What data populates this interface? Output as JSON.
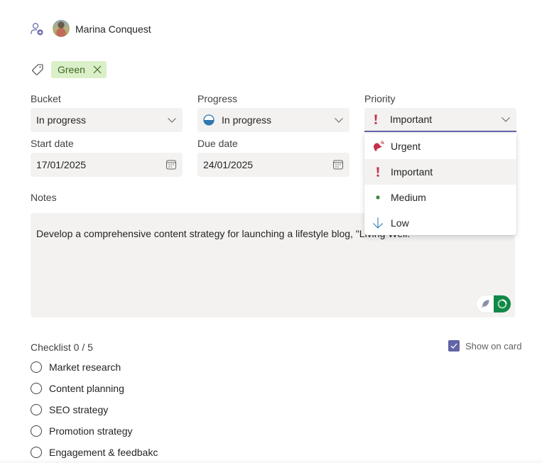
{
  "assignment": {
    "assignee_name": "Marina Conquest",
    "icon": "add-assignee-icon"
  },
  "labels": {
    "icon": "tag-icon",
    "items": [
      {
        "name": "Green",
        "bg_color": "#dbefc8",
        "text_color": "#3d6b22"
      }
    ]
  },
  "fields": {
    "bucket": {
      "label": "Bucket",
      "value": "In progress"
    },
    "progress": {
      "label": "Progress",
      "value": "In progress",
      "icon": "half-circle-progress-icon"
    },
    "priority": {
      "label": "Priority",
      "value": "Important",
      "icon": "exclamation-icon"
    },
    "start_date": {
      "label": "Start date",
      "value": "17/01/2025"
    },
    "due_date": {
      "label": "Due date",
      "value": "24/01/2025"
    }
  },
  "priority_dropdown": {
    "options": [
      {
        "label": "Urgent",
        "icon": "bell-icon",
        "color": "#c4314b"
      },
      {
        "label": "Important",
        "icon": "exclamation-icon",
        "color": "#c4314b",
        "highlighted": true
      },
      {
        "label": "Medium",
        "icon": "dot-icon",
        "color": "#3e8a3e"
      },
      {
        "label": "Low",
        "icon": "arrow-down-icon",
        "color": "#2a7ab0"
      }
    ]
  },
  "notes": {
    "label": "Notes",
    "text": "Develop a comprehensive content strategy for launching a lifestyle blog, \"Living Well.\""
  },
  "checklist": {
    "title": "Checklist 0 / 5",
    "show_on_card_label": "Show on card",
    "show_on_card_checked": true,
    "items": [
      {
        "label": "Market research",
        "checked": false
      },
      {
        "label": "Content planning",
        "checked": false
      },
      {
        "label": "SEO strategy",
        "checked": false
      },
      {
        "label": "Promotion strategy",
        "checked": false
      },
      {
        "label": "Engagement & feedbakc",
        "checked": false
      }
    ]
  },
  "colors": {
    "accent": "#6264a7",
    "field_bg": "#f3f2f1",
    "toggle_green": "#118847"
  }
}
